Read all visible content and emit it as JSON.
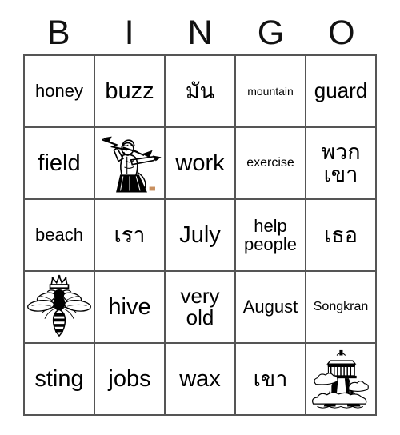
{
  "card": {
    "header_letters": [
      "B",
      "I",
      "N",
      "G",
      "O"
    ],
    "rows": [
      [
        {
          "type": "text",
          "text": "honey",
          "size": "md"
        },
        {
          "type": "text",
          "text": "buzz",
          "size": "xl"
        },
        {
          "type": "text",
          "text": "มัน",
          "size": "thai-lg"
        },
        {
          "type": "text",
          "text": "mountain",
          "size": "xs"
        },
        {
          "type": "text",
          "text": "guard",
          "size": "lg"
        }
      ],
      [
        {
          "type": "text",
          "text": "field",
          "size": "xl"
        },
        {
          "type": "image",
          "image": "zeus-thunderbolt-icon",
          "alt": "Zeus holding a thunderbolt"
        },
        {
          "type": "text",
          "text": "work",
          "size": "xl"
        },
        {
          "type": "text",
          "text": "exercise",
          "size": "sm"
        },
        {
          "type": "text",
          "text": "พวก\nเขา",
          "size": "thai-lg"
        }
      ],
      [
        {
          "type": "text",
          "text": "beach",
          "size": "md"
        },
        {
          "type": "text",
          "text": "เรา",
          "size": "thai-lg"
        },
        {
          "type": "text",
          "text": "July",
          "size": "xl"
        },
        {
          "type": "text",
          "text": "help\npeople",
          "size": "md"
        },
        {
          "type": "text",
          "text": "เธอ",
          "size": "thai-lg"
        }
      ],
      [
        {
          "type": "image",
          "image": "queen-bee-icon",
          "alt": "Queen bee wearing a crown"
        },
        {
          "type": "text",
          "text": "hive",
          "size": "xl"
        },
        {
          "type": "text",
          "text": "very\nold",
          "size": "lg"
        },
        {
          "type": "text",
          "text": "August",
          "size": "md"
        },
        {
          "type": "text",
          "text": "Songkran",
          "size": "sm"
        }
      ],
      [
        {
          "type": "text",
          "text": "sting",
          "size": "xl"
        },
        {
          "type": "text",
          "text": "jobs",
          "size": "xl"
        },
        {
          "type": "text",
          "text": "wax",
          "size": "xl"
        },
        {
          "type": "text",
          "text": "เขา",
          "size": "thai-lg"
        },
        {
          "type": "image",
          "image": "mount-olympus-temple-icon",
          "alt": "Temple on clouds atop Mount Olympus"
        }
      ]
    ]
  },
  "colors": {
    "background": "#ffffff",
    "grid_line": "#555555",
    "text": "#000000"
  }
}
